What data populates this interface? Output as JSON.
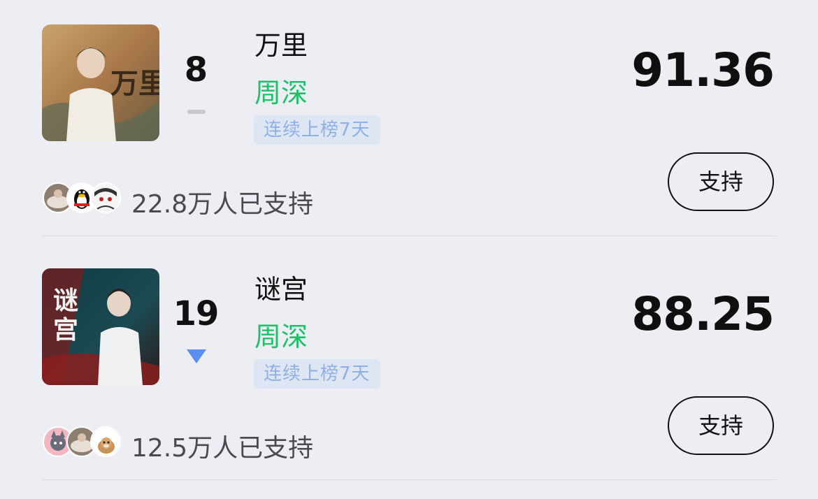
{
  "entries": [
    {
      "rank": "8",
      "trend": "flat",
      "song": "万里",
      "artist": "周深",
      "streak": "连续上榜7天",
      "score": "91.36",
      "support_label": "支持",
      "supporters": "22.8万人已支持",
      "cover_icon": "album-cover-wanli",
      "cover_text": "万里"
    },
    {
      "rank": "19",
      "trend": "down",
      "song": "谜宫",
      "artist": "周深",
      "streak": "连续上榜7天",
      "score": "88.25",
      "support_label": "支持",
      "supporters": "12.5万人已支持",
      "cover_icon": "album-cover-migong",
      "cover_text": "谜宫"
    }
  ],
  "colors": {
    "background": "#edeef3",
    "artist": "#1ec06a",
    "streak_bg": "#dfe6f3",
    "streak_text": "#8fb0e4",
    "trend_down": "#5a8ff0",
    "trend_flat": "#c9cacf"
  }
}
